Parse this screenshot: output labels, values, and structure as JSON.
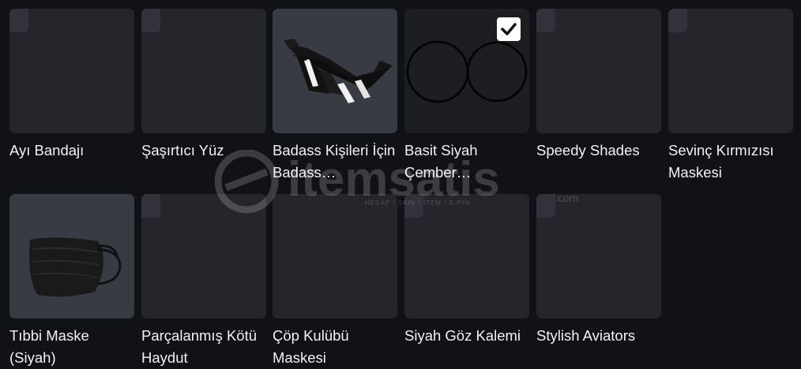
{
  "items": [
    {
      "name": "Ayı Bandajı",
      "checked": false,
      "icon": "empty-thumbnail"
    },
    {
      "name": "Şaşırtıcı Yüz",
      "checked": false,
      "icon": "empty-thumbnail"
    },
    {
      "name": "Badass Kişileri İçin Badass…",
      "checked": false,
      "icon": "badass-sunglasses-image"
    },
    {
      "name": "Basit Siyah Çember…",
      "checked": true,
      "icon": "round-glasses-image"
    },
    {
      "name": "Speedy Shades",
      "checked": false,
      "icon": "empty-thumbnail"
    },
    {
      "name": "Sevinç Kırmızısı Maskesi",
      "checked": false,
      "icon": "empty-thumbnail"
    },
    {
      "name": "Tıbbi Maske (Siyah)",
      "checked": false,
      "icon": "black-medical-mask-image"
    },
    {
      "name": "Parçalanmış Kötü Haydut",
      "checked": false,
      "icon": "empty-thumbnail"
    },
    {
      "name": "Çöp Kulübü Maskesi",
      "checked": false,
      "icon": "empty-thumbnail"
    },
    {
      "name": "Siyah Göz Kalemi",
      "checked": false,
      "icon": "empty-thumbnail"
    },
    {
      "name": "Stylish Aviators",
      "checked": false,
      "icon": "empty-thumbnail"
    }
  ],
  "watermark": {
    "logo": "itemsatis",
    "tagline": "HESAP / SKIN / ITEM / E-PIN",
    "suffix": ".com"
  }
}
